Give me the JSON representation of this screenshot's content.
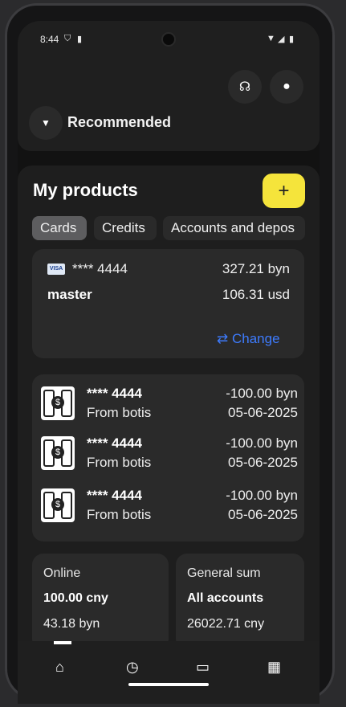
{
  "status_bar": {
    "time": "8:44"
  },
  "header": {
    "recommended_label": "Recommended"
  },
  "products": {
    "title": "My products",
    "add_symbol": "+",
    "tabs": [
      {
        "label": "Cards",
        "active": true
      },
      {
        "label": "Credits",
        "active": false
      },
      {
        "label": "Accounts and depos",
        "active": false
      }
    ],
    "card": {
      "brand": "VISA",
      "number": "**** 4444",
      "name": "master",
      "balance_primary": "327.21 byn",
      "balance_secondary": "106.31 usd",
      "change_label": "Change"
    },
    "transactions": [
      {
        "card": "**** 4444",
        "description": "From botis",
        "amount": "-100.00 byn",
        "date": "05-06-2025"
      },
      {
        "card": "**** 4444",
        "description": "From botis",
        "amount": "-100.00 byn",
        "date": "05-06-2025"
      },
      {
        "card": "**** 4444",
        "description": "From botis",
        "amount": "-100.00 byn",
        "date": "05-06-2025"
      }
    ],
    "summaries": [
      {
        "label": "Online",
        "value_bold": "100.00 cny",
        "value": "43.18 byn"
      },
      {
        "label": "General sum",
        "value_bold": "All accounts",
        "value": "26022.71 cny"
      }
    ]
  },
  "colors": {
    "accent_yellow": "#f5e43b",
    "link_blue": "#3d7bfd"
  },
  "icons": {
    "support": "headset-icon",
    "profile": "person-icon",
    "nav": [
      "home-icon",
      "clock-icon",
      "card-icon",
      "dashboard-icon"
    ]
  }
}
